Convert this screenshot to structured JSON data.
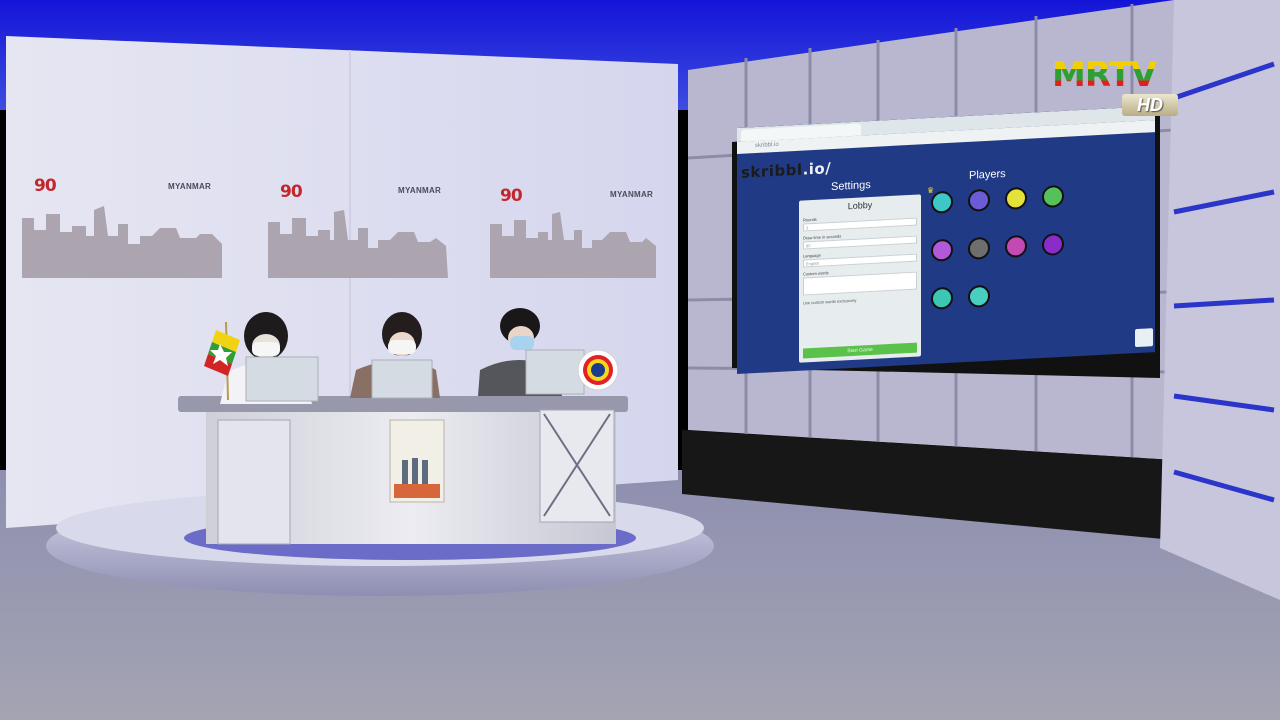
{
  "broadcast": {
    "channel_logo": "MRTV",
    "channel_badge": "HD"
  },
  "backdrop": {
    "banner_logo": "90",
    "banner_word": "MYANMAR",
    "repeats": 3
  },
  "screen": {
    "url": "skribbl.io",
    "logo_dark": "skribbl",
    "logo_light": ".io/",
    "settings_title": "Settings",
    "players_title": "Players",
    "panel": {
      "heading": "Lobby",
      "fields": [
        "Rounds",
        "Draw time in seconds",
        "Language",
        "Custom words"
      ],
      "values": [
        "3",
        "80",
        "English",
        ""
      ],
      "checkbox": "Use custom words exclusively",
      "start_button": "Start Game"
    },
    "players": [
      {
        "name": "",
        "color": "#3dc7c6",
        "owner": true
      },
      {
        "name": "",
        "color": "#6b5bd6"
      },
      {
        "name": "",
        "color": "#e4e13a"
      },
      {
        "name": "",
        "color": "#56c05a"
      },
      {
        "name": "",
        "color": "#b05ad9"
      },
      {
        "name": "",
        "color": "#6e6e6e"
      },
      {
        "name": "",
        "color": "#c44ab3"
      },
      {
        "name": "",
        "color": "#8a2cc8"
      },
      {
        "name": "",
        "color": "#3cc7b5"
      },
      {
        "name": "",
        "color": "#48cfc0"
      }
    ]
  },
  "colors": {
    "studio_blue": "#1f1fd6",
    "wall_panel": "#a9a7c6",
    "floor": "#9a9aa8",
    "screen_bg": "#203a86"
  }
}
